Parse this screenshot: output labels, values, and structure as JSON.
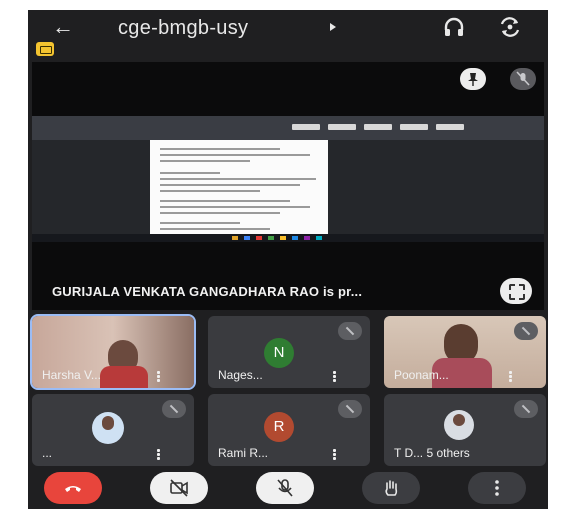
{
  "meeting": {
    "code": "cge-bmgb-usy"
  },
  "icons": {
    "back": "arrow-left-icon",
    "audio": "headphones-icon",
    "camera_switch": "camera-switch-icon",
    "recording": "recording-badge-icon",
    "pin": "pin-icon",
    "mic_off": "mic-off-icon",
    "fullscreen": "fullscreen-icon",
    "end_call": "phone-hangup-icon",
    "video_off": "video-off-icon",
    "raise_hand": "hand-icon",
    "more": "more-vertical-icon"
  },
  "colors": {
    "end_call": "#e8453c",
    "recording_badge": "#f4c430",
    "avatar_n": "#2f7d32",
    "avatar_r": "#b24a30"
  },
  "presenter": {
    "text": "GURIJALA VENKATA GANGADHARA RAO is pr..."
  },
  "participants": [
    {
      "name": "Harsha V...",
      "initial": "",
      "type": "video",
      "active_speaker": true
    },
    {
      "name": "Nages...",
      "initial": "N",
      "type": "avatar"
    },
    {
      "name": "Poonam...",
      "initial": "",
      "type": "video"
    },
    {
      "name": "...",
      "initial": "",
      "type": "photo"
    },
    {
      "name": "Rami R...",
      "initial": "R",
      "type": "avatar"
    },
    {
      "name": "T D... 5 others",
      "initial": "",
      "type": "group"
    }
  ]
}
